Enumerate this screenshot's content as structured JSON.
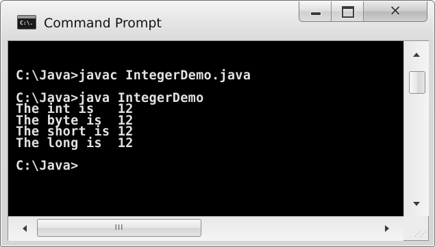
{
  "window": {
    "title": "Command Prompt",
    "icon": "console-app-icon",
    "icon_text": "C:\\.",
    "caption_buttons": {
      "minimize": "minimize-icon",
      "maximize": "maximize-icon",
      "close": "close-icon"
    }
  },
  "console": {
    "lines": [
      "",
      "C:\\Java>javac IntegerDemo.java",
      "",
      "C:\\Java>java IntegerDemo",
      "The int is   12",
      "The byte is  12",
      "The short is 12",
      "The long is  12",
      "",
      "C:\\Java>"
    ],
    "foreground": "#e2e2e2",
    "background": "#000000"
  },
  "scrollbars": {
    "horizontal_grip": "III"
  }
}
